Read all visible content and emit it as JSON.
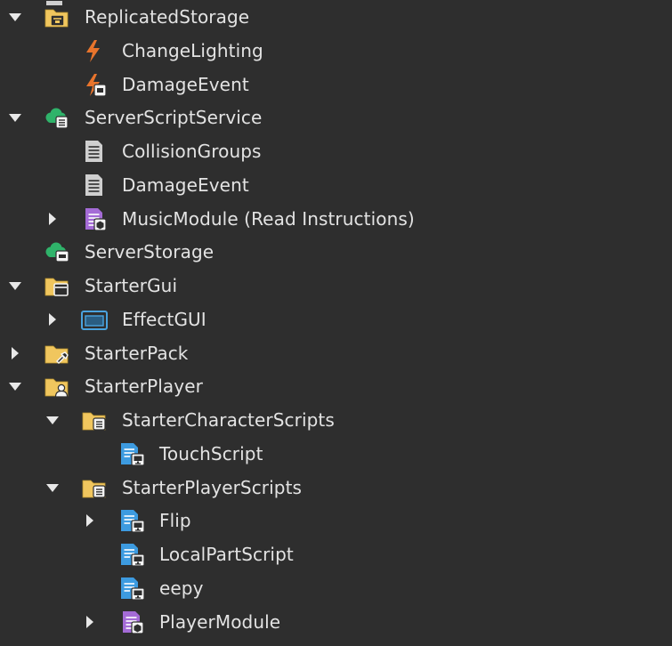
{
  "explorer": {
    "items": [
      {
        "label": "ReplicatedStorage",
        "depth": 0,
        "expander": "expanded",
        "icon": "replicated-storage-icon"
      },
      {
        "label": "ChangeLighting",
        "depth": 1,
        "expander": "none",
        "icon": "remote-event-icon"
      },
      {
        "label": "DamageEvent",
        "depth": 1,
        "expander": "none",
        "icon": "remote-event-icon"
      },
      {
        "label": "ServerScriptService",
        "depth": 0,
        "expander": "expanded",
        "icon": "server-script-service-icon"
      },
      {
        "label": "CollisionGroups",
        "depth": 1,
        "expander": "none",
        "icon": "script-icon"
      },
      {
        "label": "DamageEvent",
        "depth": 1,
        "expander": "none",
        "icon": "script-icon"
      },
      {
        "label": "MusicModule (Read Instructions)",
        "depth": 1,
        "expander": "collapsed",
        "icon": "module-script-icon"
      },
      {
        "label": "ServerStorage",
        "depth": 0,
        "expander": "none",
        "icon": "server-storage-icon"
      },
      {
        "label": "StarterGui",
        "depth": 0,
        "expander": "expanded",
        "icon": "starter-gui-icon"
      },
      {
        "label": "EffectGUI",
        "depth": 1,
        "expander": "collapsed",
        "icon": "screen-gui-icon"
      },
      {
        "label": "StarterPack",
        "depth": 0,
        "expander": "collapsed",
        "icon": "starter-pack-icon"
      },
      {
        "label": "StarterPlayer",
        "depth": 0,
        "expander": "expanded",
        "icon": "starter-player-icon"
      },
      {
        "label": "StarterCharacterScripts",
        "depth": 1,
        "expander": "expanded",
        "icon": "starter-scripts-folder-icon"
      },
      {
        "label": "TouchScript",
        "depth": 2,
        "expander": "none",
        "icon": "local-script-icon"
      },
      {
        "label": "StarterPlayerScripts",
        "depth": 1,
        "expander": "expanded",
        "icon": "starter-scripts-folder-icon"
      },
      {
        "label": "Flip",
        "depth": 2,
        "expander": "collapsed",
        "icon": "local-script-icon"
      },
      {
        "label": "LocalPartScript",
        "depth": 2,
        "expander": "none",
        "icon": "local-script-icon"
      },
      {
        "label": "eepy",
        "depth": 2,
        "expander": "none",
        "icon": "local-script-icon"
      },
      {
        "label": "PlayerModule",
        "depth": 2,
        "expander": "collapsed",
        "icon": "module-script-icon"
      }
    ]
  },
  "colors": {
    "background": "#2e2e2e",
    "text": "#e3e3e3",
    "expander": "#e8e8e8",
    "folder": "#f0c65e",
    "remote_event": "#e8742c",
    "script_page": "#cfcfcf",
    "module_purple": "#a46bd6",
    "local_blue": "#3d9be0",
    "service_green": "#2fb36a",
    "gui_blue": "#4aa3df"
  }
}
